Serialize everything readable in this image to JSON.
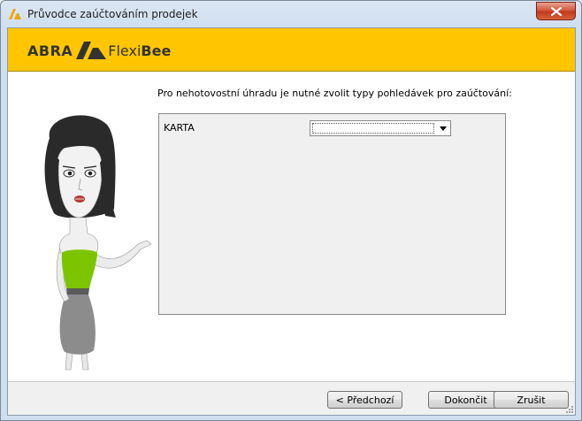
{
  "window": {
    "title": "Průvodce zaúčtováním prodejek"
  },
  "header": {
    "logo_abra": "ABRA",
    "logo_flexi": "Flexi",
    "logo_bee": "Bee"
  },
  "main": {
    "instruction": "Pro nehotovostní úhradu je nutné zvolit typy pohledávek pro zaúčtování:",
    "rows": [
      {
        "label": "KARTA",
        "selected": ""
      }
    ]
  },
  "footer": {
    "prev_label": "< Předchozí",
    "finish_label": "Dokončit",
    "cancel_label": "Zrušit"
  },
  "colors": {
    "brand_yellow": "#ffc600",
    "dress_green": "#7dc400",
    "close_red": "#c8432a"
  },
  "icons": {
    "app": "abra-logo-icon",
    "close": "close-icon",
    "dropdown": "chevron-down-icon",
    "grip": "resize-grip-icon"
  }
}
